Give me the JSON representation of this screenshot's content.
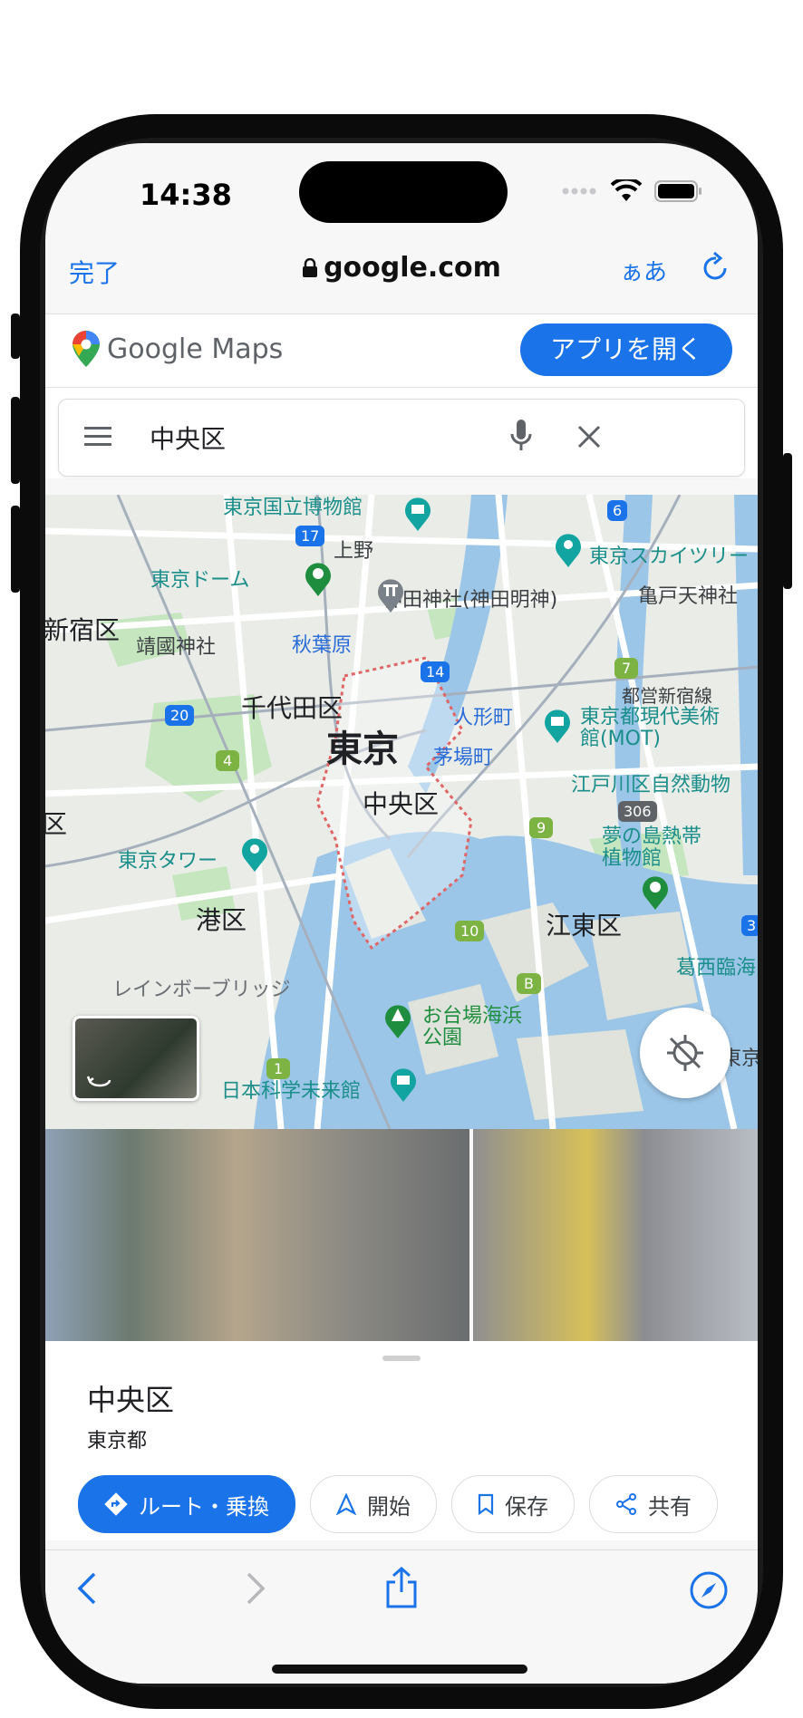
{
  "status_bar": {
    "time": "14:38"
  },
  "safari": {
    "done_label": "完了",
    "url": "google.com",
    "text_size_label": "ぁあ"
  },
  "maps_header": {
    "logo_text": "Google Maps",
    "open_app_label": "アプリを開く"
  },
  "search": {
    "query": "中央区"
  },
  "map": {
    "labels": {
      "tokyo": "東京",
      "chuo": "中央区",
      "chiyoda": "千代田区",
      "minato": "港区",
      "koto": "江東区",
      "shinjuku": "新宿区",
      "national_museum": "東京国立博物館",
      "tokyo_dome": "東京ドーム",
      "ueno": "上野",
      "kanda_shrine": "神田神社(神田明神)",
      "skytree": "東京スカイツリー",
      "kameido": "亀戸天神社",
      "yasukuni": "靖國神社",
      "akihabara": "秋葉原",
      "ningyocho": "人形町",
      "kayabacho": "茅場町",
      "mot": "東京都現代美術館(MOT)",
      "shinjuku_line": "都営新宿線",
      "edogawa_zoo": "江戸川区自然動物",
      "yumenoshima": "夢の島熱帯植物館",
      "tokyo_tower": "東京タワー",
      "rainbow_bridge": "レインボーブリッジ",
      "odaiba": "お台場海浜公園",
      "miraikan": "日本科学未来館",
      "kasai": "葛西臨海",
      "ku_left": "区",
      "tokyo_right": "東京"
    },
    "route_numbers": [
      "17",
      "6",
      "14",
      "7",
      "20",
      "4",
      "306",
      "9",
      "10",
      "B",
      "1",
      "3"
    ]
  },
  "place": {
    "name": "中央区",
    "subtitle": "東京都"
  },
  "actions": [
    {
      "label": "ルート・乗換",
      "icon": "directions-icon"
    },
    {
      "label": "開始",
      "icon": "navigation-icon"
    },
    {
      "label": "保存",
      "icon": "bookmark-icon"
    },
    {
      "label": "共有",
      "icon": "share-icon"
    }
  ],
  "colors": {
    "accent": "#1a73e8",
    "map_water": "#9cc6e8",
    "map_land": "#e9ece7",
    "park": "#c6e6c0"
  }
}
